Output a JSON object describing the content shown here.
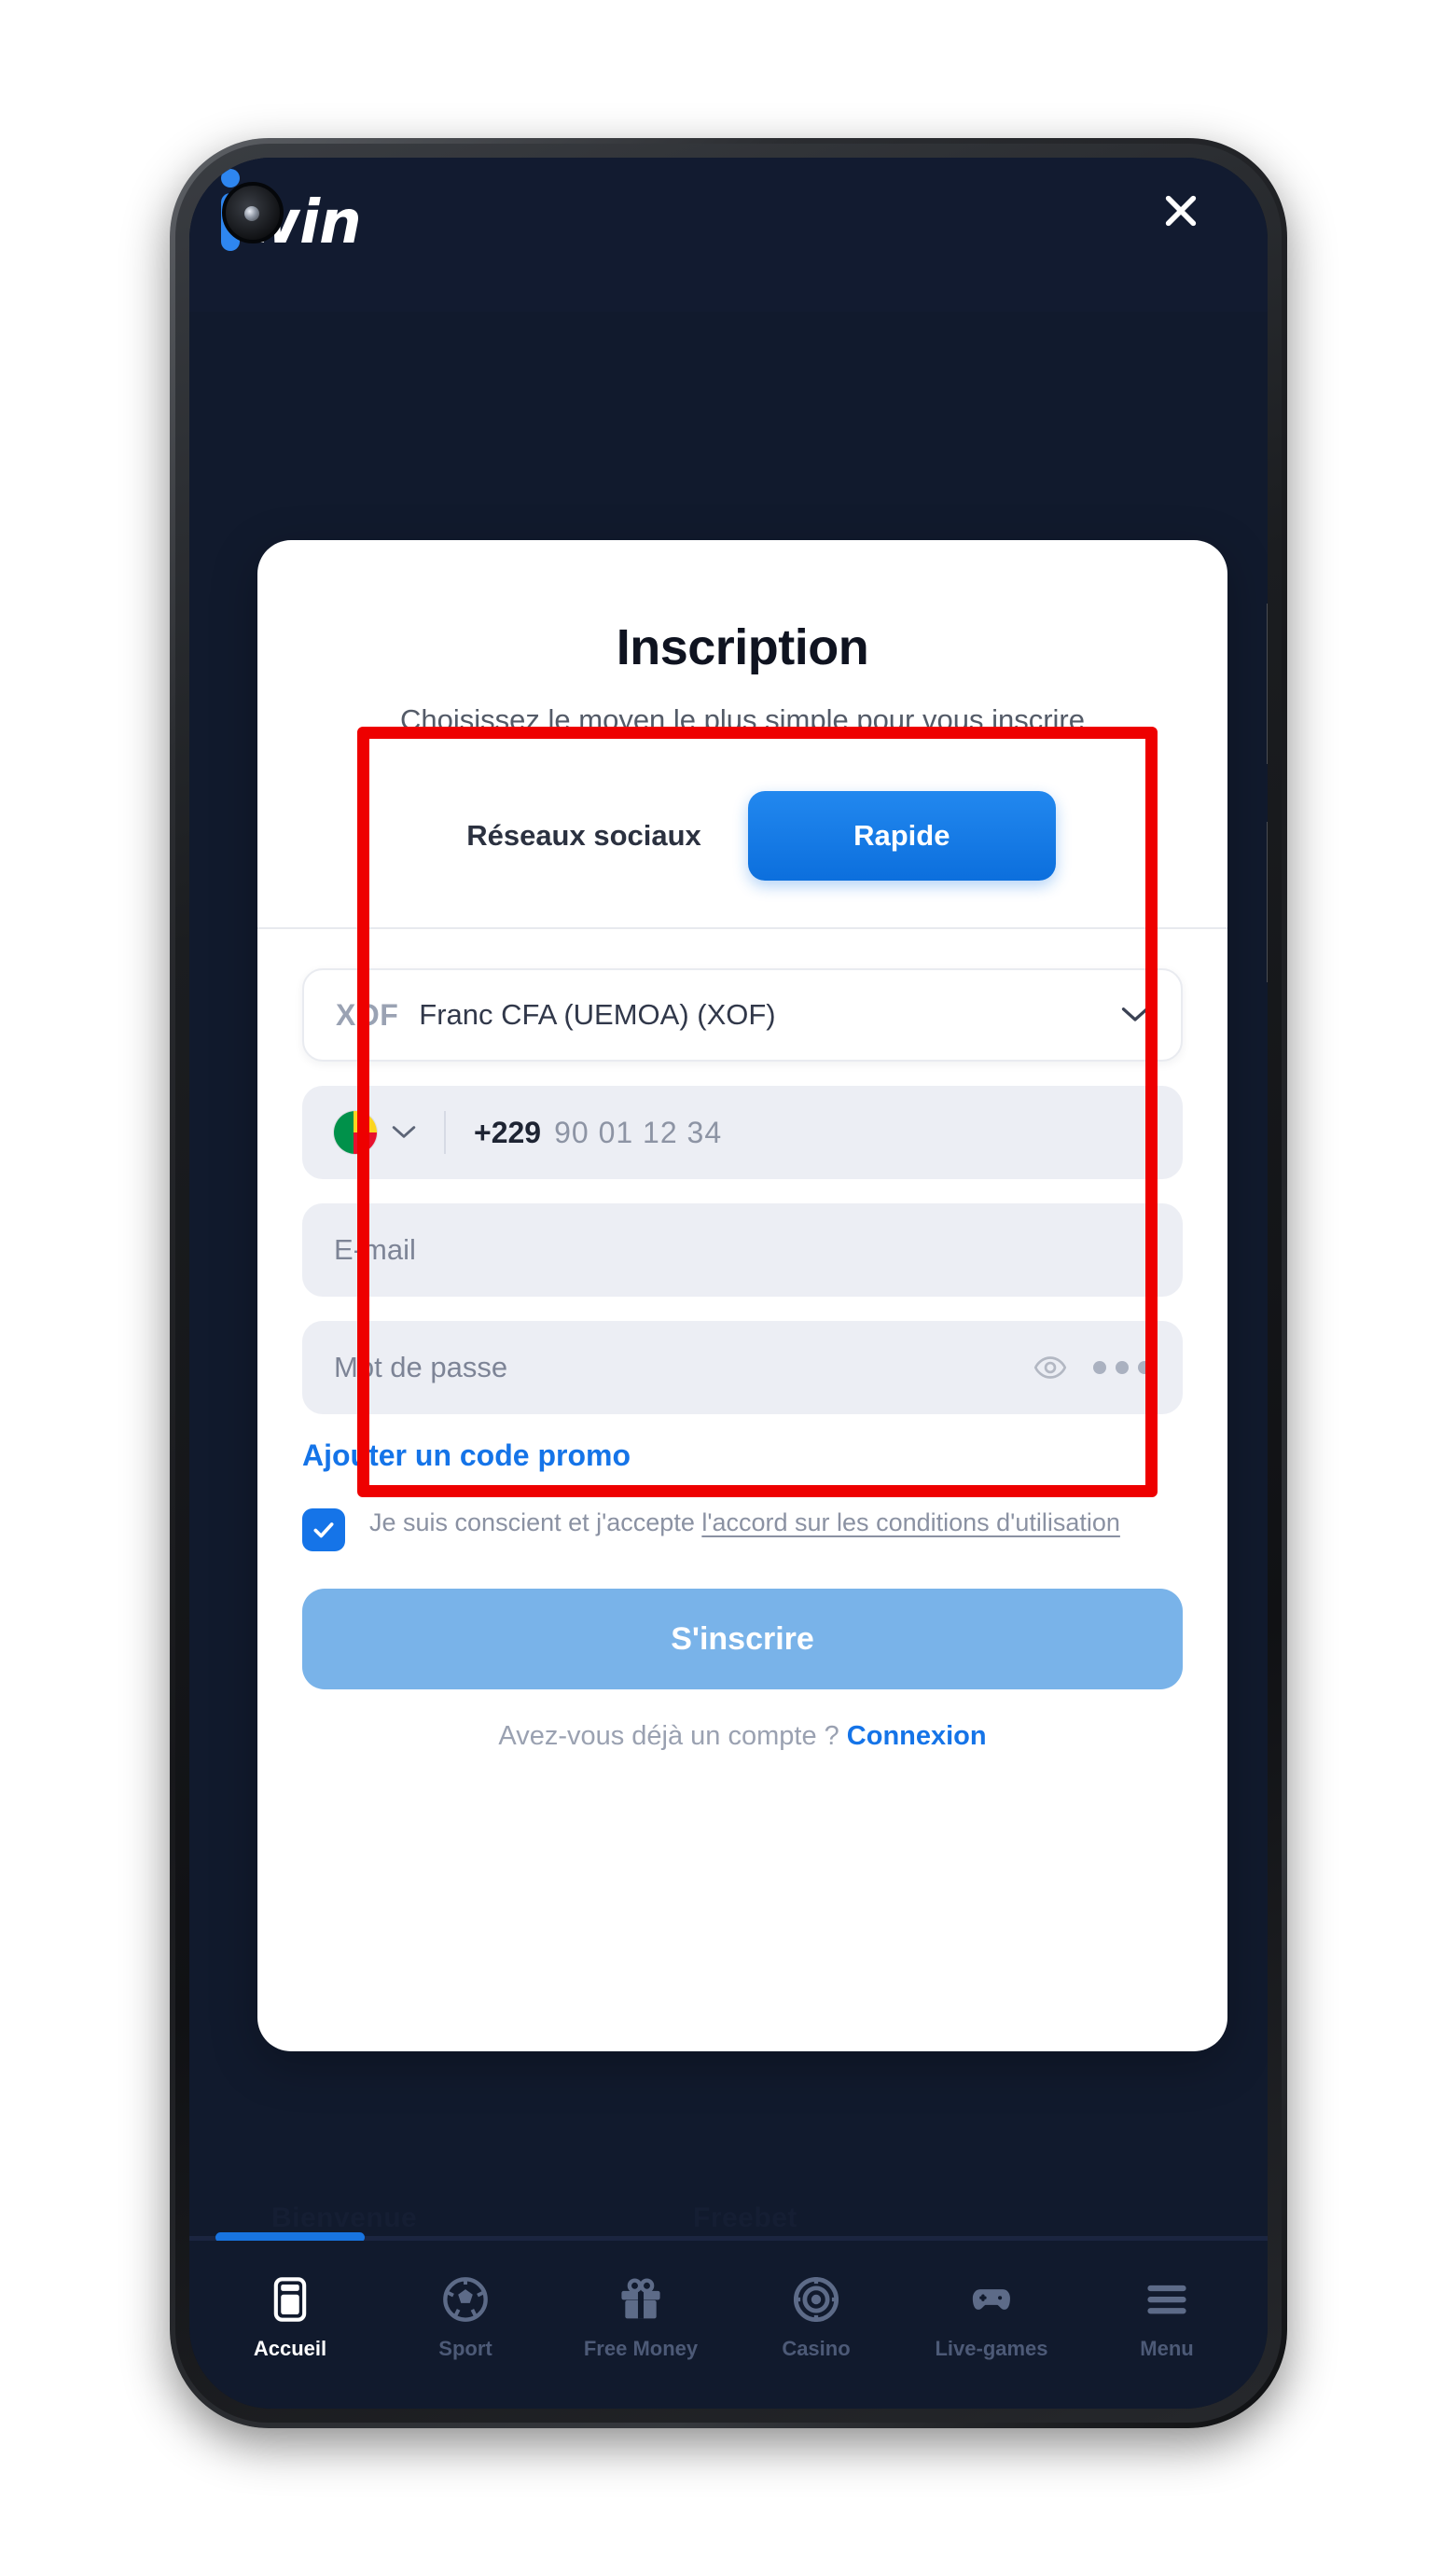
{
  "app": {
    "logo_text": "win",
    "close_icon": "close-icon"
  },
  "background": {
    "ghost_text_left": "Bienvenue",
    "ghost_text_right": "Freebet"
  },
  "modal": {
    "title": "Inscription",
    "subtitle": "Choisissez le moyen le plus simple pour vous inscrire",
    "tabs": [
      {
        "label": "Réseaux sociaux",
        "active": false
      },
      {
        "label": "Rapide",
        "active": true
      }
    ],
    "form": {
      "currency": {
        "code": "XOF",
        "name": "Franc CFA (UEMOA) (XOF)",
        "chevron_icon": "chevron-down-icon"
      },
      "phone": {
        "flag_icon": "benin-flag-icon",
        "chevron_icon": "chevron-down-icon",
        "dial_code": "+229",
        "placeholder": "90 01 12 34"
      },
      "email": {
        "placeholder": "E-mail"
      },
      "password": {
        "placeholder": "Mot de passe",
        "eye_icon": "eye-icon",
        "generate_icon": "three-dots-icon"
      },
      "promo_label": "Ajouter un code promo",
      "terms": {
        "checked": true,
        "text_prefix": "Je suis conscient et j'accepte ",
        "link_text": "l'accord sur les conditions d'utilisation"
      },
      "submit_label": "S'inscrire",
      "login_prompt": "Avez-vous déjà un compte ?",
      "login_link": "Connexion"
    }
  },
  "bottom_nav": [
    {
      "label": "Accueil",
      "icon": "mobile-phone-icon",
      "active": true
    },
    {
      "label": "Sport",
      "icon": "soccer-ball-icon",
      "active": false
    },
    {
      "label": "Free Money",
      "icon": "gift-icon",
      "active": false
    },
    {
      "label": "Casino",
      "icon": "casino-chip-icon",
      "active": false
    },
    {
      "label": "Live-games",
      "icon": "gamepad-icon",
      "active": false
    },
    {
      "label": "Menu",
      "icon": "hamburger-icon",
      "active": false
    }
  ],
  "colors": {
    "brand_blue": "#1574e8",
    "tab_active_blue": "#1279e5",
    "submit_disabled": "#79b3e9",
    "app_bg": "#111a2d",
    "annotation_red": "#ee0000"
  }
}
